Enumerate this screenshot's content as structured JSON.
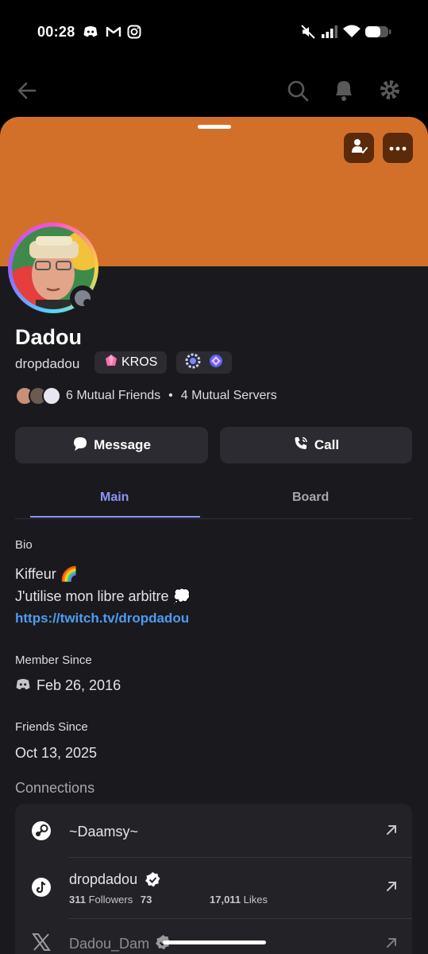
{
  "status_bar": {
    "time": "00:28",
    "icons": [
      "discord-icon",
      "gmail-icon",
      "instagram-icon",
      "mute-icon",
      "signal-icon",
      "wifi-icon",
      "battery-icon"
    ]
  },
  "background_header": {
    "icons": [
      "back-arrow-icon",
      "search-icon",
      "bell-icon",
      "gear-icon"
    ]
  },
  "banner": {
    "color": "#d2702a",
    "buttons": [
      "friend-status-icon",
      "more-icon"
    ]
  },
  "profile": {
    "display_name": "Dadou",
    "username": "dropdadou",
    "clan_tag": "KROS",
    "status": "offline"
  },
  "mutuals": {
    "friends": "6 Mutual Friends",
    "separator": "•",
    "servers": "4 Mutual Servers"
  },
  "actions": {
    "message": "Message",
    "call": "Call"
  },
  "tabs": {
    "main": "Main",
    "board": "Board"
  },
  "bio": {
    "label": "Bio",
    "line1": "Kiffeur 🌈",
    "line2": "J'utilise mon libre arbitre 💭",
    "link": "https://twitch.tv/dropdadou"
  },
  "member_since": {
    "label": "Member Since",
    "date": "Feb 26, 2016"
  },
  "friends_since": {
    "label": "Friends Since",
    "date": "Oct 13, 2025"
  },
  "connections": {
    "label": "Connections",
    "items": [
      {
        "service": "steam",
        "name": "~Daamsy~"
      },
      {
        "service": "tiktok",
        "name": "dropdadou",
        "followers_count": "311",
        "followers_label": "Followers",
        "following_count": "73",
        "likes_count": "17,011",
        "likes_label": "Likes"
      },
      {
        "service": "x",
        "name": "Dadou_Dam"
      }
    ]
  },
  "colors": {
    "accent": "#8b95f5",
    "link": "#4d9cf1",
    "banner": "#d2702a",
    "sheet": "#1a1a1e"
  }
}
